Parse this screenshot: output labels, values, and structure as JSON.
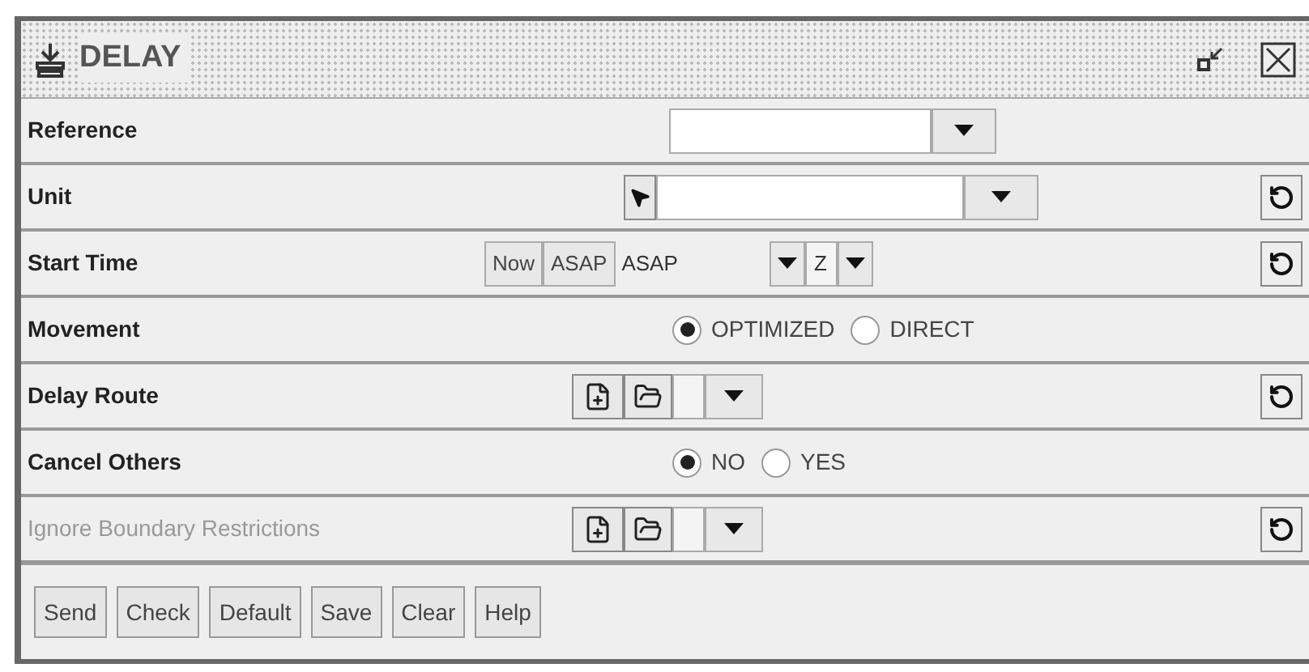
{
  "window": {
    "title": "DELAY"
  },
  "rows": [
    {
      "kind": "combo",
      "label": "Reference",
      "disabled": false,
      "reset": false
    },
    {
      "kind": "unit",
      "label": "Unit",
      "disabled": false,
      "reset": true
    },
    {
      "kind": "time",
      "label": "Start Time",
      "disabled": false,
      "reset": true,
      "buttons": [
        "Now",
        "ASAP"
      ],
      "value": "ASAP",
      "zone": "Z"
    },
    {
      "kind": "radio",
      "label": "Movement",
      "disabled": false,
      "reset": false,
      "options": [
        {
          "label": "OPTIMIZED",
          "selected": true
        },
        {
          "label": "DIRECT",
          "selected": false
        }
      ]
    },
    {
      "kind": "route",
      "label": "Delay Route",
      "disabled": false,
      "reset": true
    },
    {
      "kind": "radio",
      "label": "Cancel Others",
      "disabled": false,
      "reset": false,
      "options": [
        {
          "label": "NO",
          "selected": true
        },
        {
          "label": "YES",
          "selected": false
        }
      ]
    },
    {
      "kind": "route",
      "label": "Ignore Boundary Restrictions",
      "disabled": true,
      "reset": true
    }
  ],
  "buttons": [
    "Send",
    "Check",
    "Default",
    "Save",
    "Clear",
    "Help"
  ]
}
